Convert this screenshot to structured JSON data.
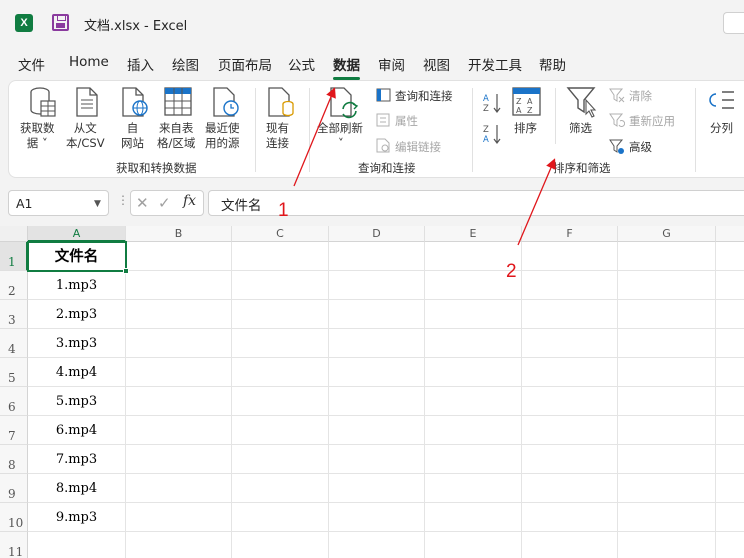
{
  "titlebar": {
    "app_icon_letter": "X",
    "title": "文档.xlsx  -  Excel"
  },
  "tabs": [
    {
      "label": "文件"
    },
    {
      "label": "Home"
    },
    {
      "label": "插入"
    },
    {
      "label": "绘图"
    },
    {
      "label": "页面布局"
    },
    {
      "label": "公式"
    },
    {
      "label": "数据"
    },
    {
      "label": "审阅"
    },
    {
      "label": "视图"
    },
    {
      "label": "开发工具"
    },
    {
      "label": "帮助"
    }
  ],
  "active_tab": "数据",
  "ribbon": {
    "get_data": {
      "group_label": "获取和转换数据",
      "buttons": [
        {
          "label": "获取数\n据 ˅"
        },
        {
          "label": "从文\n本/CSV"
        },
        {
          "label": "自\n网站"
        },
        {
          "label": "来自表\n格/区域"
        },
        {
          "label": "最近使\n用的源"
        },
        {
          "label": "现有\n连接"
        }
      ]
    },
    "queries": {
      "group_label": "查询和连接",
      "refresh_label": "全部刷新",
      "refresh_caret": "˅",
      "queries_label": "查询和连接",
      "properties_label": "属性",
      "edit_links_label": "编辑链接"
    },
    "sort_filter": {
      "group_label": "排序和筛选",
      "sort_label": "排序",
      "filter_label": "筛选",
      "clear_label": "清除",
      "reapply_label": "重新应用",
      "advanced_label": "高级"
    },
    "data_tools": {
      "split_label": "分列"
    }
  },
  "formula_bar": {
    "name_box": "A1",
    "fx": "fx",
    "content": "文件名"
  },
  "columns": [
    "A",
    "B",
    "C",
    "D",
    "E",
    "F",
    "G"
  ],
  "rows": [
    "1",
    "2",
    "3",
    "4",
    "5",
    "6",
    "7",
    "8",
    "9",
    "10",
    "11"
  ],
  "cells_col_a": [
    "文件名",
    "1.mp3",
    "2.mp3",
    "3.mp3",
    "4.mp4",
    "5.mp3",
    "6.mp4",
    "7.mp3",
    "8.mp4",
    "9.mp3",
    ""
  ],
  "annotations": [
    {
      "label": "1"
    },
    {
      "label": "2"
    }
  ],
  "colors": {
    "accent": "#107c41",
    "annotation": "#e0161b"
  }
}
